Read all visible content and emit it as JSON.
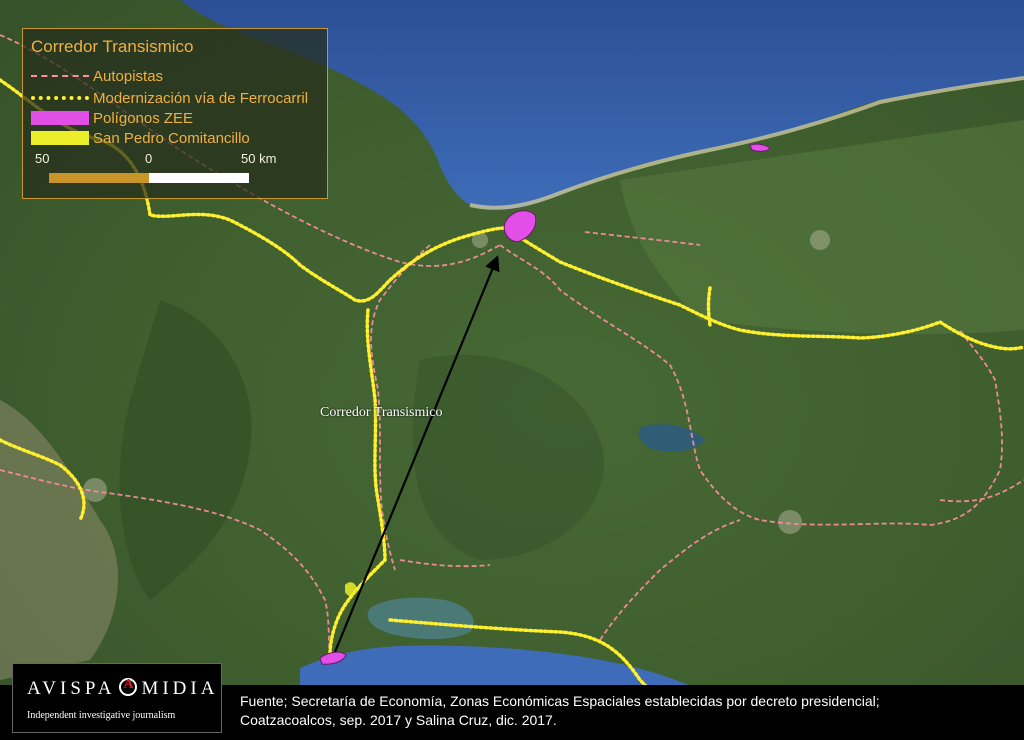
{
  "legend": {
    "title": "Corredor Transismico",
    "items": [
      {
        "label": "Autopistas",
        "symbol": "dashed-line",
        "color": "#ff8fa0"
      },
      {
        "label": "Modernización vía de Ferrocarril",
        "symbol": "dotted-line",
        "color": "#ffef2e"
      },
      {
        "label": "Polígonos ZEE",
        "symbol": "filled-box",
        "color": "#e14fe6"
      },
      {
        "label": "San Pedro Comitancillo",
        "symbol": "filled-box",
        "color": "#ecee2a"
      }
    ],
    "scale": {
      "left": "50",
      "middle": "0",
      "right": "50 km"
    }
  },
  "map": {
    "label": "Corredor Transismico",
    "colors": {
      "sea": "#2f5aa3",
      "land": "#4b6b37",
      "highway": "#ff8fa0",
      "railway": "#ffef2e",
      "zee": "#e14fe6"
    }
  },
  "footer": {
    "line1": "Fuente; Secretaría de Economía, Zonas Económicas Espaciales establecidas por decreto presidencial;",
    "line2": "Coatzacoalcos, sep. 2017 y Salina Cruz, dic. 2017."
  },
  "logo": {
    "name_left": "AVISPA",
    "name_right": "MIDIA",
    "tagline": "Independent investigative journalism"
  }
}
